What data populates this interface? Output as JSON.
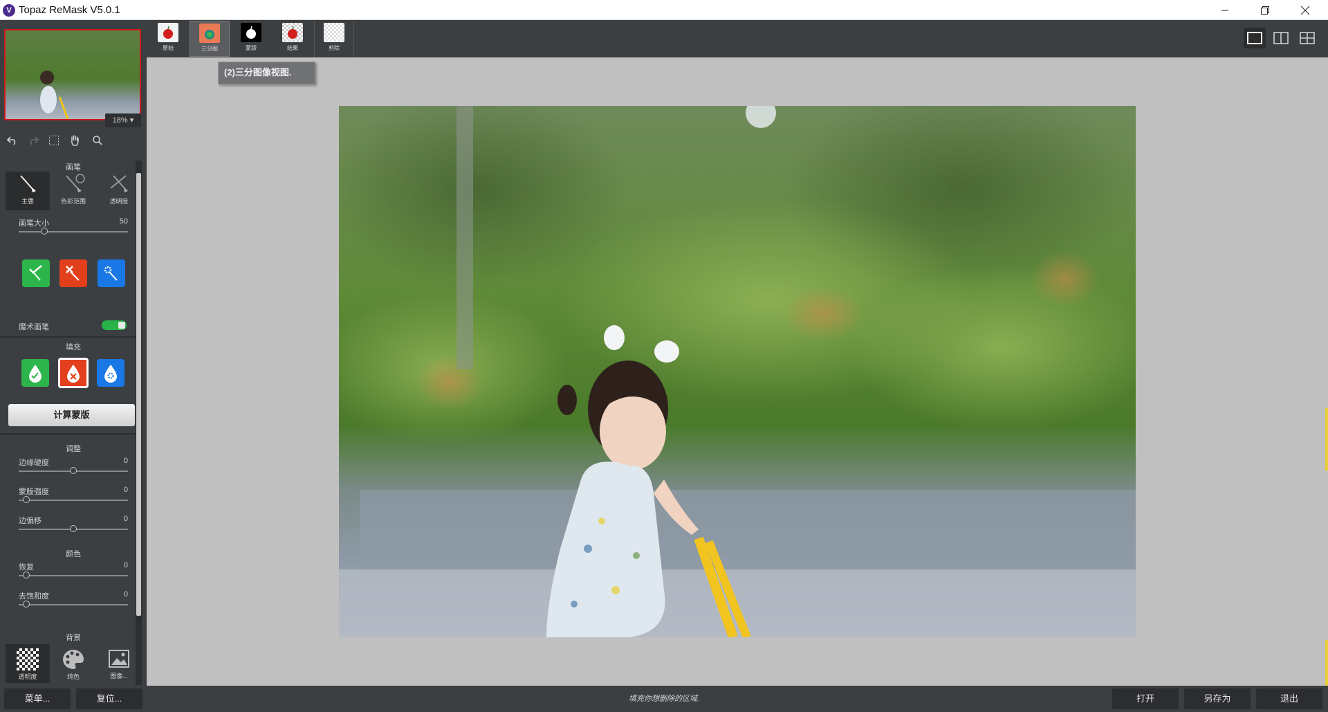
{
  "window": {
    "title": "Topaz ReMask V5.0.1",
    "logo_letter": "V"
  },
  "zoom": "18%",
  "brush_section": {
    "title": "画笔",
    "tools": [
      "主要",
      "色彩范围",
      "透明度"
    ],
    "size_label": "画笔大小",
    "size_value": "50",
    "magic_brush_label": "魔术画笔"
  },
  "fill_section": {
    "title": "填充"
  },
  "compute_button": "计算蒙版",
  "adjust_section": {
    "title": "调整",
    "sliders": [
      {
        "label": "边缘硬度",
        "value": "0"
      },
      {
        "label": "蒙版强度",
        "value": "0"
      },
      {
        "label": "边偏移",
        "value": "0"
      }
    ]
  },
  "color_section": {
    "title": "颜色",
    "sliders": [
      {
        "label": "恢复",
        "value": "0"
      },
      {
        "label": "去饱和度",
        "value": "0"
      }
    ]
  },
  "background_section": {
    "title": "背景",
    "tools": [
      "透明度",
      "纯色",
      "图像..."
    ]
  },
  "view_tabs": [
    "原始",
    "三分图",
    "蒙版",
    "结果",
    "剪除"
  ],
  "tooltip": "(2)三分图像视图.",
  "bottom": {
    "menu": "菜单...",
    "reset": "复位...",
    "status": "填充你想删除的区域.",
    "open": "打开",
    "save_as": "另存为",
    "exit": "退出"
  },
  "colors": {
    "green": "#2cb54a",
    "red": "#e2401c",
    "blue": "#1a78e6",
    "accent_yellow": "#e8cf3a"
  },
  "photo_description_icons": [
    "photo-preview"
  ]
}
